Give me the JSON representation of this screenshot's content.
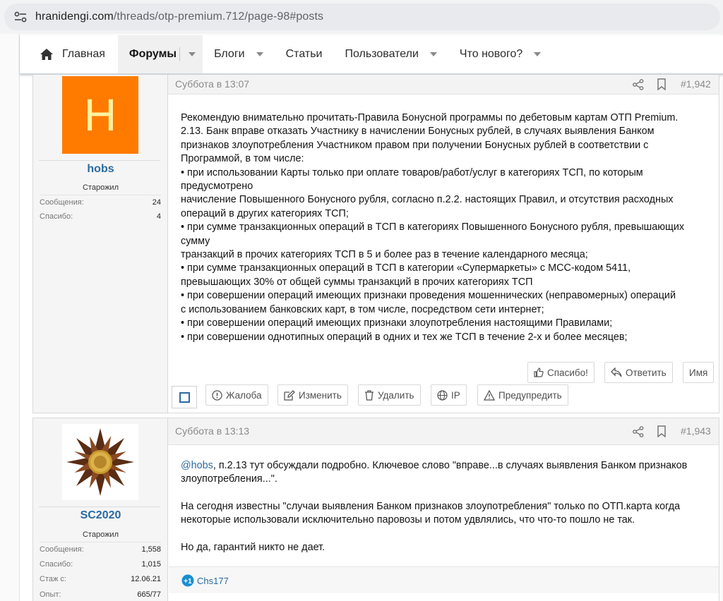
{
  "browser": {
    "url_host": "hranidengi.com",
    "url_path": "/threads/otp-premium.712/page-98#posts"
  },
  "nav": {
    "home": "Главная",
    "forums": "Форумы",
    "blogs": "Блоги",
    "articles": "Статьи",
    "users": "Пользователи",
    "whats_new": "Что нового?"
  },
  "posts": [
    {
      "avatar_letter": "H",
      "username": "hobs",
      "user_title": "Старожил",
      "stats": [
        {
          "key": "Сообщения:",
          "value": "24"
        },
        {
          "key": "Спасибо:",
          "value": "4"
        }
      ],
      "date": "Суббота в 13:07",
      "number": "#1,942",
      "body_lines": [
        "Рекомендую внимательно прочитать-Правила Бонусной программы по дебетовым картам ОТП Premium.",
        "2.13. Банк вправе отказать Участнику в начислении Бонусных рублей, в случаях выявления Банком",
        "признаков злоупотребления Участником правом при получении Бонусных рублей в соответствии с",
        "Программой, в том числе:",
        "• при использовании Карты только при оплате товаров/работ/услуг в категориях ТСП, по которым",
        "предусмотрено",
        "начисление Повышенного Бонусного рубля, согласно п.2.2. настоящих Правил, и отсутствия расходных",
        "операций в других категориях ТСП;",
        "• при сумме транзакционных операций в ТСП в категориях Повышенного Бонусного рубля, превышающих",
        "сумму",
        "транзакций в прочих категориях ТСП в 5 и более раз в течение календарного месяца;",
        "• при сумме транзакционных операций в ТСП в категории «Супермаркеты» с MCC-кодом 5411,",
        "превышающих 30% от общей суммы транзакций в прочих категориях ТСП",
        "• при совершении операций имеющих признаки проведения мошеннических (неправомерных) операций",
        "с использованием банковских карт, в том числе, посредством сети интернет;",
        "• при совершении операций имеющих признаки злоупотребления настоящими Правилами;",
        "• при совершении однотипных операций в одних и тех же ТСП в течение 2-х и более месяцев;"
      ],
      "actions": {
        "thanks": "Спасибо!",
        "reply": "Ответить",
        "name": "Имя",
        "report": "Жалоба",
        "edit": "Изменить",
        "delete": "Удалить",
        "ip": "IP",
        "warn": "Предупредить"
      }
    },
    {
      "username": "SC2020",
      "user_title": "Старожил",
      "stats": [
        {
          "key": "Сообщения:",
          "value": "1,558"
        },
        {
          "key": "Спасибо:",
          "value": "1,015"
        },
        {
          "key": "Стаж с:",
          "value": "12.06.21"
        },
        {
          "key": "Опыт:",
          "value": "665/77"
        }
      ],
      "date": "Суббота в 13:13",
      "number": "#1,943",
      "mention": "@hobs",
      "body_line1_rest": ", п.2.13 тут обсуждали подробно. Ключевое слово \"вправе...в случаях выявления Банком признаков",
      "body_line2": "злоупотребления...\".",
      "body_line3": "На сегодня известны \"случаи выявления Банком признаков злоупотребления\" только по ОТП.карта когда",
      "body_line4": "некоторые использовали исключительно паровозы и потом удвлялись, что что-то пошло не так.",
      "body_line5": "Но да, гарантий никто не дает.",
      "reaction_user": "Chs177"
    }
  ],
  "colors": {
    "link": "#2b6aa0",
    "avatar_bg": "#ff7b00",
    "avatar_letter": "#fff3a0"
  }
}
